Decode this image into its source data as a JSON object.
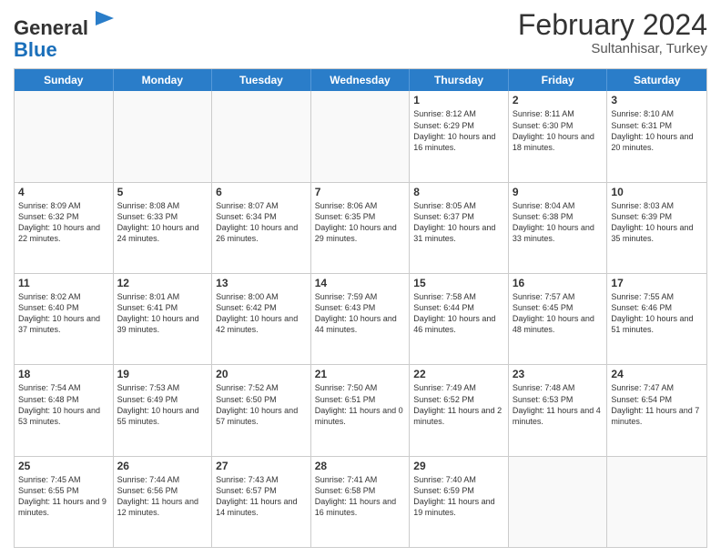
{
  "header": {
    "logo_general": "General",
    "logo_blue": "Blue",
    "month_year": "February 2024",
    "location": "Sultanhisar, Turkey"
  },
  "days_of_week": [
    "Sunday",
    "Monday",
    "Tuesday",
    "Wednesday",
    "Thursday",
    "Friday",
    "Saturday"
  ],
  "rows": [
    [
      {
        "day": "",
        "text": ""
      },
      {
        "day": "",
        "text": ""
      },
      {
        "day": "",
        "text": ""
      },
      {
        "day": "",
        "text": ""
      },
      {
        "day": "1",
        "text": "Sunrise: 8:12 AM\nSunset: 6:29 PM\nDaylight: 10 hours and 16 minutes."
      },
      {
        "day": "2",
        "text": "Sunrise: 8:11 AM\nSunset: 6:30 PM\nDaylight: 10 hours and 18 minutes."
      },
      {
        "day": "3",
        "text": "Sunrise: 8:10 AM\nSunset: 6:31 PM\nDaylight: 10 hours and 20 minutes."
      }
    ],
    [
      {
        "day": "4",
        "text": "Sunrise: 8:09 AM\nSunset: 6:32 PM\nDaylight: 10 hours and 22 minutes."
      },
      {
        "day": "5",
        "text": "Sunrise: 8:08 AM\nSunset: 6:33 PM\nDaylight: 10 hours and 24 minutes."
      },
      {
        "day": "6",
        "text": "Sunrise: 8:07 AM\nSunset: 6:34 PM\nDaylight: 10 hours and 26 minutes."
      },
      {
        "day": "7",
        "text": "Sunrise: 8:06 AM\nSunset: 6:35 PM\nDaylight: 10 hours and 29 minutes."
      },
      {
        "day": "8",
        "text": "Sunrise: 8:05 AM\nSunset: 6:37 PM\nDaylight: 10 hours and 31 minutes."
      },
      {
        "day": "9",
        "text": "Sunrise: 8:04 AM\nSunset: 6:38 PM\nDaylight: 10 hours and 33 minutes."
      },
      {
        "day": "10",
        "text": "Sunrise: 8:03 AM\nSunset: 6:39 PM\nDaylight: 10 hours and 35 minutes."
      }
    ],
    [
      {
        "day": "11",
        "text": "Sunrise: 8:02 AM\nSunset: 6:40 PM\nDaylight: 10 hours and 37 minutes."
      },
      {
        "day": "12",
        "text": "Sunrise: 8:01 AM\nSunset: 6:41 PM\nDaylight: 10 hours and 39 minutes."
      },
      {
        "day": "13",
        "text": "Sunrise: 8:00 AM\nSunset: 6:42 PM\nDaylight: 10 hours and 42 minutes."
      },
      {
        "day": "14",
        "text": "Sunrise: 7:59 AM\nSunset: 6:43 PM\nDaylight: 10 hours and 44 minutes."
      },
      {
        "day": "15",
        "text": "Sunrise: 7:58 AM\nSunset: 6:44 PM\nDaylight: 10 hours and 46 minutes."
      },
      {
        "day": "16",
        "text": "Sunrise: 7:57 AM\nSunset: 6:45 PM\nDaylight: 10 hours and 48 minutes."
      },
      {
        "day": "17",
        "text": "Sunrise: 7:55 AM\nSunset: 6:46 PM\nDaylight: 10 hours and 51 minutes."
      }
    ],
    [
      {
        "day": "18",
        "text": "Sunrise: 7:54 AM\nSunset: 6:48 PM\nDaylight: 10 hours and 53 minutes."
      },
      {
        "day": "19",
        "text": "Sunrise: 7:53 AM\nSunset: 6:49 PM\nDaylight: 10 hours and 55 minutes."
      },
      {
        "day": "20",
        "text": "Sunrise: 7:52 AM\nSunset: 6:50 PM\nDaylight: 10 hours and 57 minutes."
      },
      {
        "day": "21",
        "text": "Sunrise: 7:50 AM\nSunset: 6:51 PM\nDaylight: 11 hours and 0 minutes."
      },
      {
        "day": "22",
        "text": "Sunrise: 7:49 AM\nSunset: 6:52 PM\nDaylight: 11 hours and 2 minutes."
      },
      {
        "day": "23",
        "text": "Sunrise: 7:48 AM\nSunset: 6:53 PM\nDaylight: 11 hours and 4 minutes."
      },
      {
        "day": "24",
        "text": "Sunrise: 7:47 AM\nSunset: 6:54 PM\nDaylight: 11 hours and 7 minutes."
      }
    ],
    [
      {
        "day": "25",
        "text": "Sunrise: 7:45 AM\nSunset: 6:55 PM\nDaylight: 11 hours and 9 minutes."
      },
      {
        "day": "26",
        "text": "Sunrise: 7:44 AM\nSunset: 6:56 PM\nDaylight: 11 hours and 12 minutes."
      },
      {
        "day": "27",
        "text": "Sunrise: 7:43 AM\nSunset: 6:57 PM\nDaylight: 11 hours and 14 minutes."
      },
      {
        "day": "28",
        "text": "Sunrise: 7:41 AM\nSunset: 6:58 PM\nDaylight: 11 hours and 16 minutes."
      },
      {
        "day": "29",
        "text": "Sunrise: 7:40 AM\nSunset: 6:59 PM\nDaylight: 11 hours and 19 minutes."
      },
      {
        "day": "",
        "text": ""
      },
      {
        "day": "",
        "text": ""
      }
    ]
  ]
}
